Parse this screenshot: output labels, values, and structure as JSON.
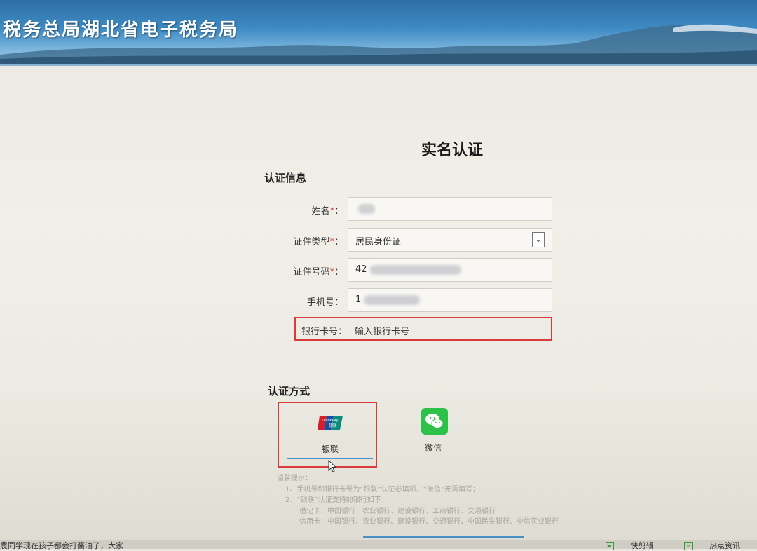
{
  "header": {
    "title": "税务总局湖北省电子税务局"
  },
  "page": {
    "title": "实名认证"
  },
  "form": {
    "section_title": "认证信息",
    "name": {
      "label": "姓名",
      "required_mark": "*",
      "colon": "：",
      "value": ""
    },
    "id_type": {
      "label": "证件类型",
      "required_mark": "*",
      "colon": "：",
      "value": "居民身份证"
    },
    "id_number": {
      "label": "证件号码",
      "required_mark": "*",
      "colon": "：",
      "value": "42"
    },
    "phone": {
      "label": "手机号",
      "colon": "：",
      "value": "1"
    },
    "bank_card": {
      "label": "银行卡号：",
      "placeholder": "输入银行卡号"
    }
  },
  "auth_methods": {
    "section_title": "认证方式",
    "unionpay": {
      "label": "银联",
      "logo_text_top": "UnionPay",
      "logo_text_bottom": "银联"
    },
    "wechat": {
      "label": "微信"
    }
  },
  "tips": {
    "title": "温馨提示：",
    "line1": "1、手机号和银行卡号为“银联”认证必填项，“微信”无需填写；",
    "line2": "2、“银联”认证支持的银行如下：",
    "debit": "借记卡：中国银行、农业银行、建设银行、工商银行、交通银行",
    "credit": "信用卡：中国银行、农业银行、建设银行、交通银行、中国民生银行、中信实业银行"
  },
  "taskbar": {
    "news": "農同学现在孩子都会打酱油了，大家",
    "item1": "快剪辑",
    "item2": "热点资讯"
  },
  "colors": {
    "required": "#d22222",
    "highlight": "#d93a3a",
    "accent": "#4a90c8",
    "wechat": "#2dc14a"
  }
}
